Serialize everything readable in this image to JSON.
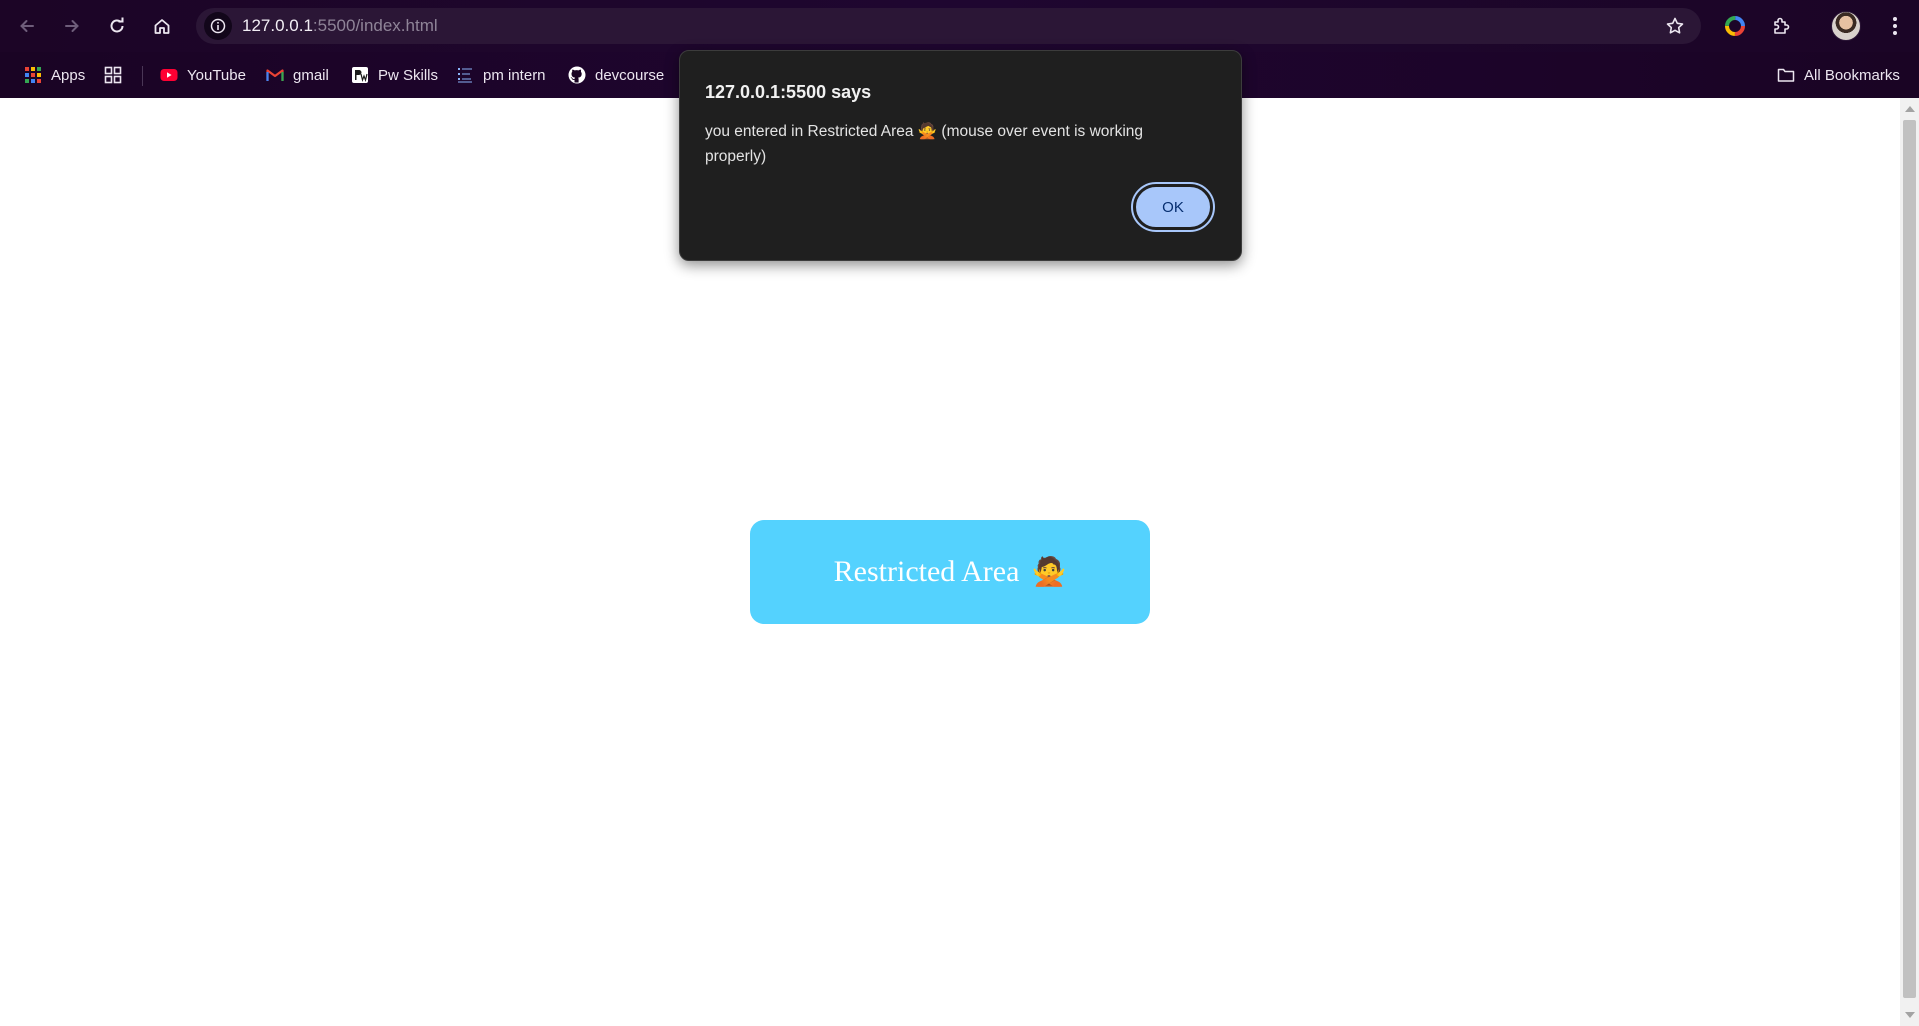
{
  "browser": {
    "url_host": "127.0.0.1",
    "url_rest": ":5500/index.html",
    "bookmarks": [
      {
        "label": "Apps",
        "icon": "apps-grid-icon"
      },
      {
        "label": "YouTube",
        "icon": "youtube-icon"
      },
      {
        "label": "gmail",
        "icon": "gmail-icon"
      },
      {
        "label": "Pw Skills",
        "icon": "pwskills-icon"
      },
      {
        "label": "pm intern",
        "icon": "pm-intern-icon"
      },
      {
        "label": "devcourse",
        "icon": "github-icon"
      }
    ],
    "all_bookmarks_label": "All Bookmarks"
  },
  "page": {
    "restricted_label": "Restricted Area",
    "restricted_emoji": "🙅"
  },
  "dialog": {
    "title": "127.0.0.1:5500 says",
    "message": "you entered in Restricted Area 🙅 (mouse over event is working properly)",
    "ok_label": "OK"
  },
  "colors": {
    "chrome_bg": "#1f0530",
    "restricted_bg": "#54d2fe",
    "dialog_bg": "#1f1f1f",
    "ok_bg": "#a8c7fa"
  }
}
